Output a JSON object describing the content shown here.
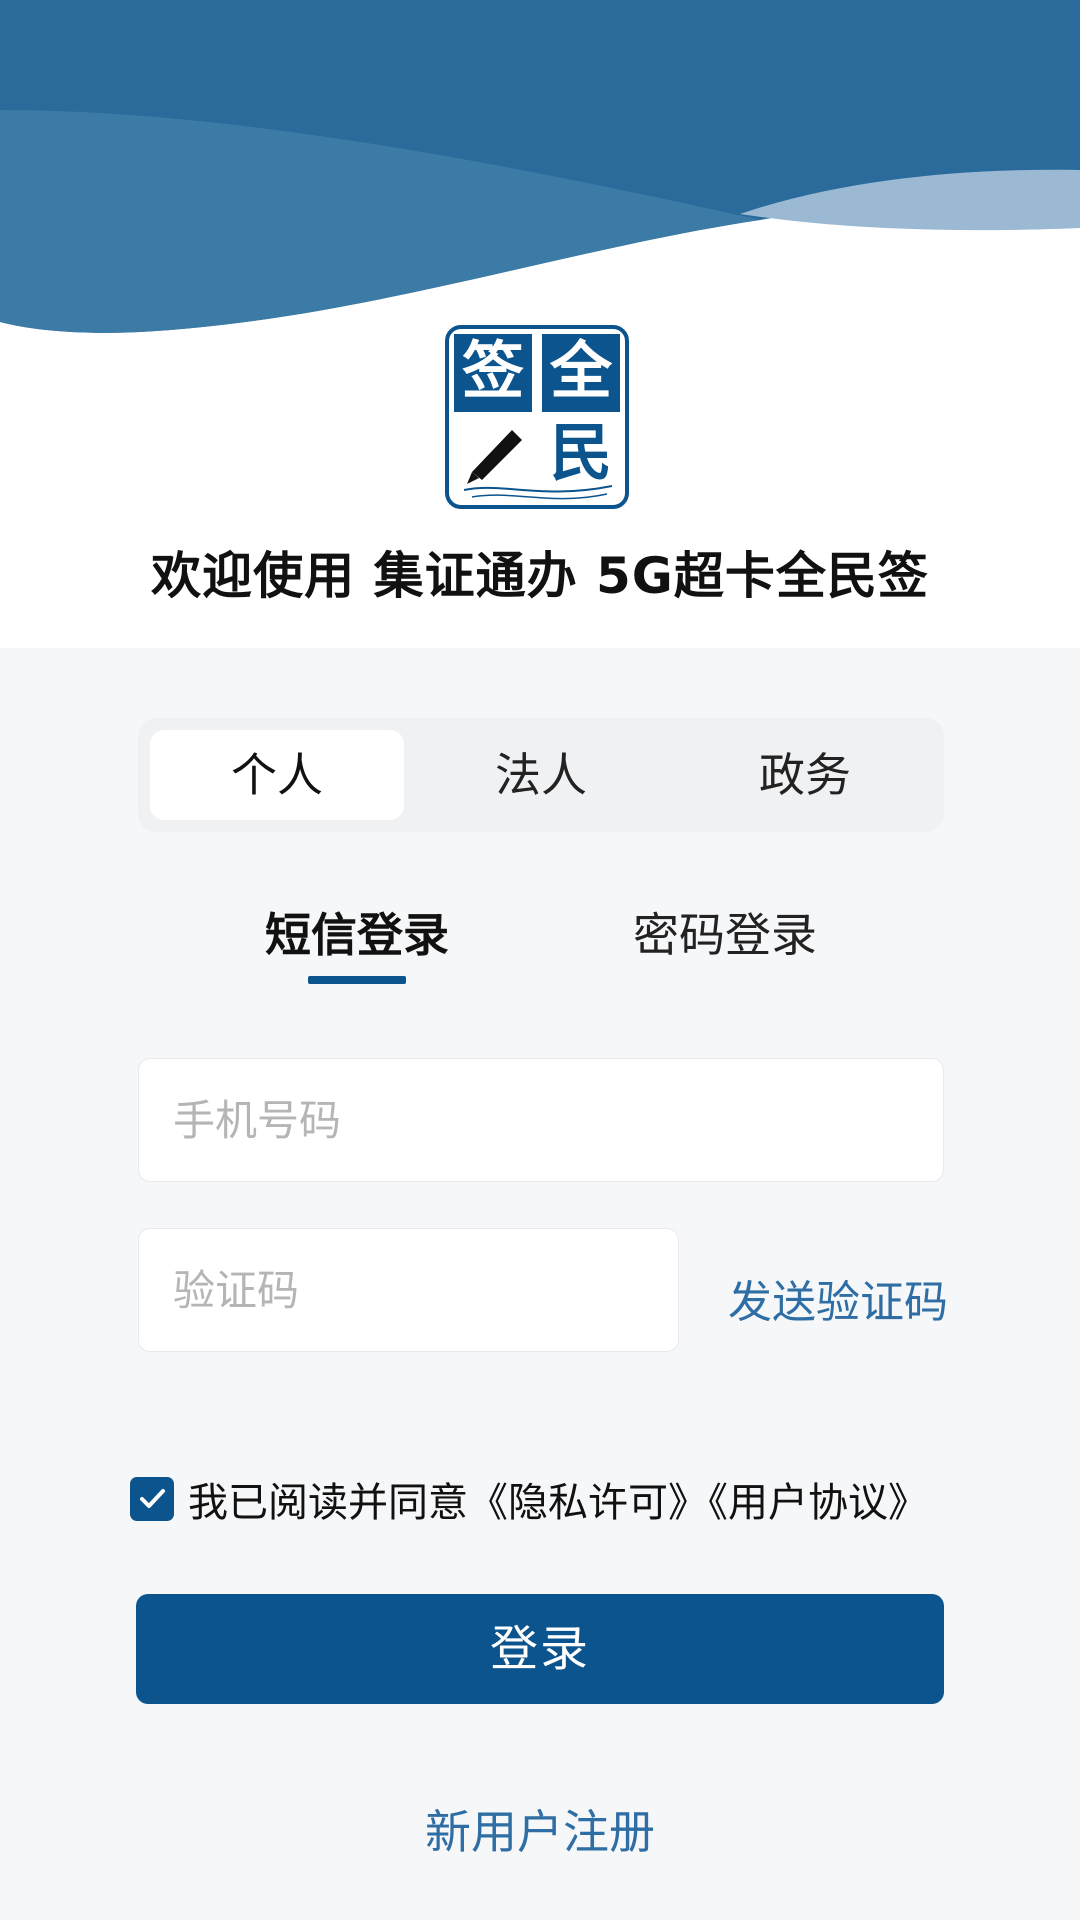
{
  "header": {
    "welcome": "欢迎使用 集证通办 5G超卡全民签",
    "logo": {
      "chars": [
        "签",
        "全",
        "民"
      ],
      "color": "#0c548d"
    }
  },
  "role_tabs": [
    {
      "label": "个人",
      "active": true
    },
    {
      "label": "法人",
      "active": false
    },
    {
      "label": "政务",
      "active": false
    }
  ],
  "login_tabs": [
    {
      "label": "短信登录",
      "active": true
    },
    {
      "label": "密码登录",
      "active": false
    }
  ],
  "form": {
    "phone_placeholder": "手机号码",
    "phone_value": "",
    "code_placeholder": "验证码",
    "code_value": "",
    "send_code_label": "发送验证码"
  },
  "agreement": {
    "checked": true,
    "text": "我已阅读并同意《隐私许可》《用户协议》"
  },
  "login_button": "登录",
  "register_link": "新用户注册",
  "colors": {
    "primary": "#0c548d",
    "link": "#2f6ea4",
    "wave": "#2a6b9c",
    "background": "#f6f7f9"
  }
}
